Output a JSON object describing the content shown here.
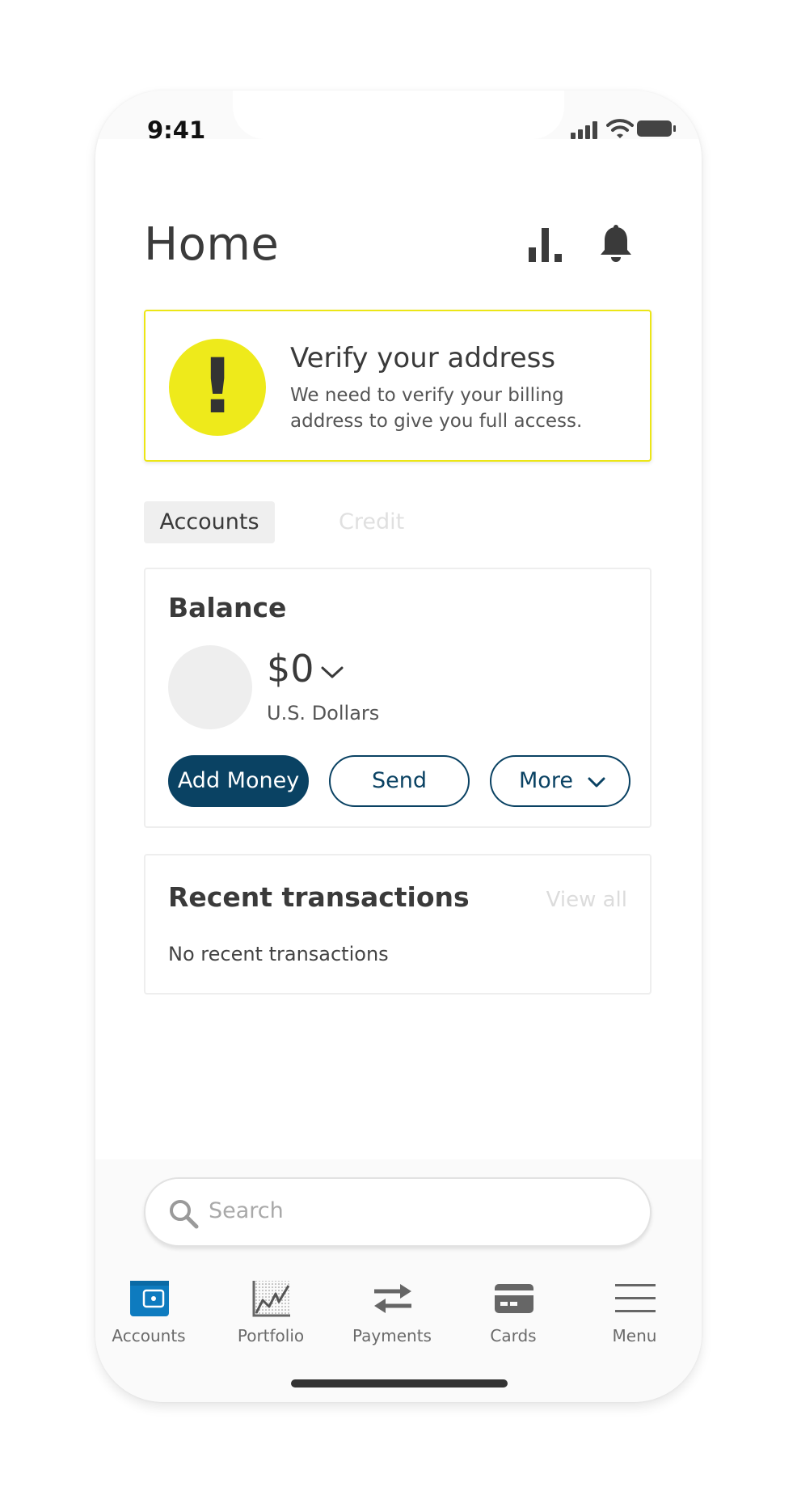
{
  "status_bar": {
    "time": "9:41"
  },
  "header": {
    "title": "Home",
    "stats_icon": "stats-icon",
    "bell_icon": "bell-icon"
  },
  "alert": {
    "icon": "exclamation-icon",
    "symbol": "!",
    "title": "Verify your address",
    "body": "We need to verify your billing address to give you full access.",
    "color": "#eeea1b"
  },
  "tabs": [
    {
      "label": "Accounts",
      "active": true
    },
    {
      "label": "Credit",
      "active": false
    }
  ],
  "balance": {
    "title": "Balance",
    "amount": "$0",
    "currency": "U.S. Dollars",
    "actions": {
      "add_money": "Add Money",
      "send": "Send",
      "more": "More"
    },
    "accent": "#0a4263"
  },
  "transactions": {
    "title": "Recent transactions",
    "view_all": "View all",
    "empty": "No recent transactions"
  },
  "search": {
    "placeholder": "Search"
  },
  "bottom_nav": [
    {
      "label": "Accounts",
      "icon": "wallet-icon",
      "active": true,
      "color": "#0e7bbf"
    },
    {
      "label": "Portfolio",
      "icon": "portfolio-chart-icon",
      "active": false
    },
    {
      "label": "Payments",
      "icon": "transfer-arrows-icon",
      "active": false
    },
    {
      "label": "Cards",
      "icon": "card-icon",
      "active": false
    },
    {
      "label": "Menu",
      "icon": "hamburger-menu-icon",
      "active": false
    }
  ]
}
